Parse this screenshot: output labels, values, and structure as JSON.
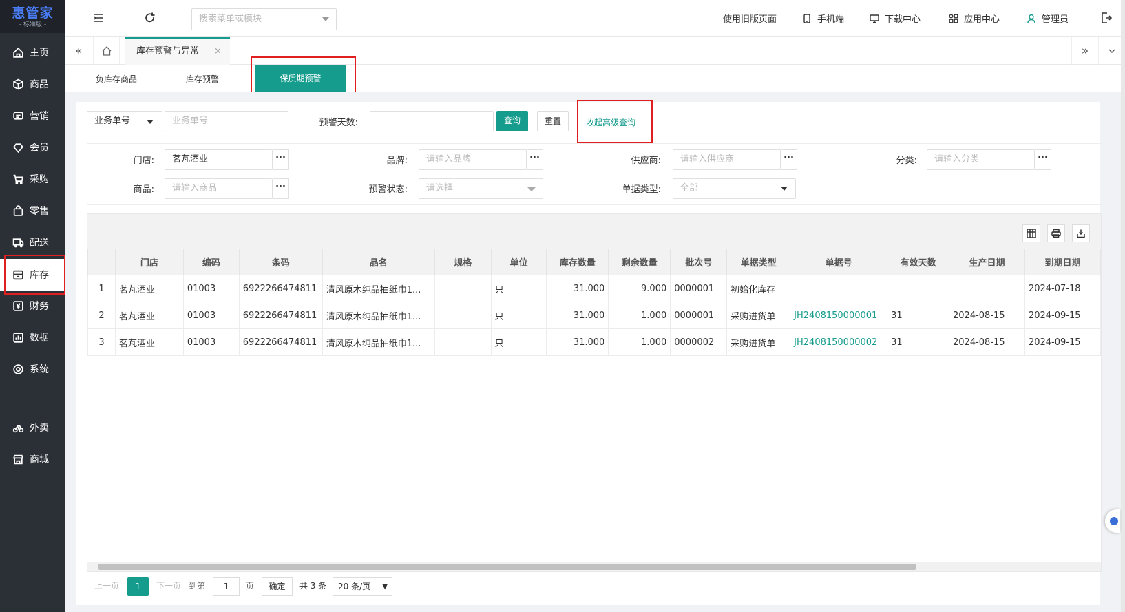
{
  "logo": {
    "name": "惠管家",
    "edition": "- 标准版 -"
  },
  "sidebar": {
    "items": [
      {
        "label": "主页",
        "icon": "home-icon"
      },
      {
        "label": "商品",
        "icon": "box-icon"
      },
      {
        "label": "营销",
        "icon": "message-icon"
      },
      {
        "label": "会员",
        "icon": "diamond-icon"
      },
      {
        "label": "采购",
        "icon": "cart-icon"
      },
      {
        "label": "零售",
        "icon": "bag-icon"
      },
      {
        "label": "配送",
        "icon": "truck-icon"
      },
      {
        "label": "库存",
        "icon": "storage-icon"
      },
      {
        "label": "财务",
        "icon": "yen-icon"
      },
      {
        "label": "数据",
        "icon": "chart-icon"
      },
      {
        "label": "系统",
        "icon": "settings-icon"
      },
      {
        "label": "外卖",
        "icon": "bike-icon"
      },
      {
        "label": "商城",
        "icon": "shop-icon"
      }
    ],
    "active": "库存"
  },
  "topbar": {
    "search_placeholder": "搜索菜单或模块",
    "old_version": "使用旧版页面",
    "mobile": "手机端",
    "download": "下载中心",
    "apps": "应用中心",
    "user": "管理员"
  },
  "tabs": {
    "current": "库存预警与异常",
    "close": "×"
  },
  "subtabs": {
    "negative_stock": "负库存商品",
    "stock_alert": "库存预警",
    "expiry_alert": "保质期预警"
  },
  "filters": {
    "doc_type_select": "业务单号",
    "doc_no_placeholder": "业务单号",
    "alert_days_label": "预警天数:",
    "alert_days_value": "",
    "query_button": "查询",
    "reset_button": "重置",
    "collapse_link": "收起高级查询",
    "store_label": "门店:",
    "store_value": "茗芃酒业",
    "brand_label": "品牌:",
    "brand_placeholder": "请输入品牌",
    "supplier_label": "供应商:",
    "supplier_placeholder": "请输入供应商",
    "category_label": "分类:",
    "category_placeholder": "请输入分类",
    "product_label": "商品:",
    "product_placeholder": "请输入商品",
    "alert_status_label": "预警状态:",
    "alert_status_placeholder": "请选择",
    "bill_type_label": "单据类型:",
    "bill_type_value": "全部",
    "more": "···"
  },
  "table": {
    "columns": [
      "",
      "门店",
      "编码",
      "条码",
      "品名",
      "规格",
      "单位",
      "库存数量",
      "剩余数量",
      "批次号",
      "单据类型",
      "单据号",
      "有效天数",
      "生产日期",
      "到期日期"
    ],
    "rows": [
      [
        "1",
        "茗芃酒业",
        "01003",
        "6922266474811",
        "清风原木纯品抽纸巾1...",
        "",
        "只",
        "31.000",
        "9.000",
        "0000001",
        "初始化库存",
        "",
        "",
        "",
        "2024-07-18"
      ],
      [
        "2",
        "茗芃酒业",
        "01003",
        "6922266474811",
        "清风原木纯品抽纸巾1...",
        "",
        "只",
        "31.000",
        "1.000",
        "0000001",
        "采购进货单",
        "JH2408150000001",
        "31",
        "2024-08-15",
        "2024-09-15"
      ],
      [
        "3",
        "茗芃酒业",
        "01003",
        "6922266474811",
        "清风原木纯品抽纸巾1...",
        "",
        "只",
        "31.000",
        "1.000",
        "0000002",
        "采购进货单",
        "JH2408150000002",
        "31",
        "2024-08-15",
        "2024-09-15"
      ]
    ]
  },
  "pager": {
    "prev": "上一页",
    "current": "1",
    "next": "下一页",
    "goto": "到第",
    "page_input": "1",
    "page_unit": "页",
    "confirm": "确定",
    "total": "共 3 条",
    "page_size": "20 条/页"
  },
  "colors": {
    "accent": "#159c8c",
    "sidebar": "#2b2f36",
    "highlight": "#e02020"
  }
}
